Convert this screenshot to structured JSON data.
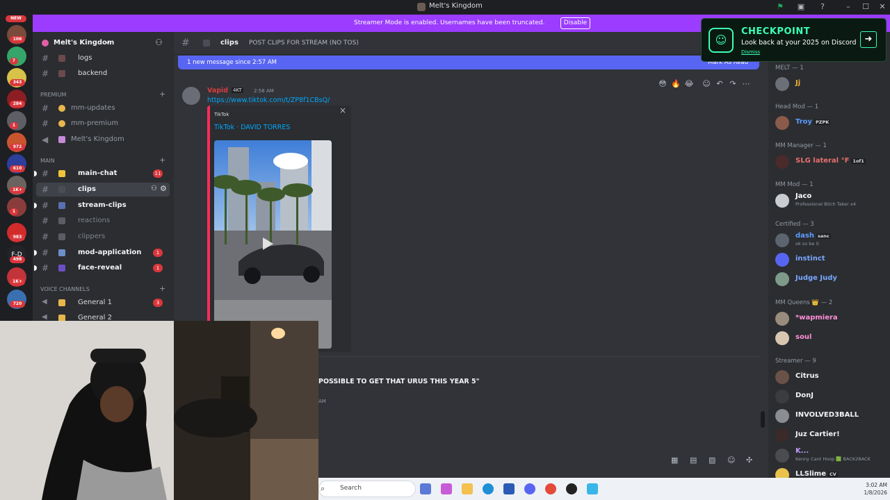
{
  "window": {
    "title": "Melt's Kingdom"
  },
  "banner": {
    "text": "Streamer Mode is enabled. Usernames have been truncated.",
    "disable_label": "Disable"
  },
  "rail": {
    "new_label": "NEW",
    "badges": [
      "106",
      "7",
      "343",
      "284",
      "1",
      "972",
      "610",
      "1K+",
      "1",
      "983",
      "498",
      "1K+",
      "720"
    ]
  },
  "guild": {
    "name": "Melt's Kingdom"
  },
  "categories": {
    "premium": "PREMIUM",
    "main": "MAIN",
    "voice": "VOICE CHANNELS"
  },
  "channels": {
    "top": [
      {
        "name": "logs"
      },
      {
        "name": "backend"
      }
    ],
    "premium": [
      {
        "name": "mm-updates"
      },
      {
        "name": "mm-premium"
      },
      {
        "name": "Melt's Kingdom"
      }
    ],
    "main": [
      {
        "name": "main-chat",
        "badge": "11"
      },
      {
        "name": "clips"
      },
      {
        "name": "stream-clips"
      },
      {
        "name": "reactions"
      },
      {
        "name": "clippers"
      },
      {
        "name": "mod-application",
        "badge": "1"
      },
      {
        "name": "face-reveal",
        "badge": "1"
      }
    ],
    "voice": [
      {
        "name": "General 1",
        "badge": "3"
      },
      {
        "name": "General 2"
      }
    ]
  },
  "header": {
    "channel": "clips",
    "topic": "POST CLIPS FOR STREAM (NO TOS)"
  },
  "new_messages": {
    "text": "1 new message since 2:57 AM",
    "mark_read": "Mark As Read"
  },
  "message": {
    "author": "Vapid",
    "badge": "4KT",
    "time": "2:58 AM",
    "link": "https://www.tiktok.com/t/ZP8f1CBsQ/",
    "embed_provider": "TikTok",
    "embed_title": "TikTok · DAVID TORRES",
    "close": "×"
  },
  "next_message": {
    "text": "POSSIBLE TO GET THAT URUS THIS YEAR 5\"",
    "time": "AM"
  },
  "checkpoint": {
    "title": "CHECKPOINT",
    "subtitle": "Look back at your 2025 on Discord",
    "dismiss": "Dismiss"
  },
  "members": {
    "groups": [
      {
        "title": "MELT — 1",
        "items": [
          {
            "name": "Jj",
            "color": "#f0b232"
          }
        ]
      },
      {
        "title": "Head Mod — 1",
        "items": [
          {
            "name": "Troy",
            "tag": "PZPK",
            "color": "#5b9cff"
          }
        ]
      },
      {
        "title": "MM Manager — 1",
        "items": [
          {
            "name": "SLG lateral °F",
            "tag": "1of1",
            "color": "#e9706c"
          }
        ]
      },
      {
        "title": "MM Mod — 1",
        "items": [
          {
            "name": "Jaco",
            "status": "Professional Bitch Taker x4",
            "color": "#ffffff"
          }
        ]
      },
      {
        "title": "Certified — 3",
        "items": [
          {
            "name": "dash",
            "tag": "sanc",
            "status": "ok so be it",
            "color": "#5b9cff"
          },
          {
            "name": "instinct",
            "color": "#7aa8ff"
          },
          {
            "name": "Judge Judy",
            "color": "#7aa8ff"
          }
        ]
      },
      {
        "title": "MM Queens 👑 — 2",
        "items": [
          {
            "name": "*wapmiera",
            "color": "#ff8fd8"
          },
          {
            "name": "soul",
            "color": "#ff8fd8"
          }
        ]
      },
      {
        "title": "Streamer — 9",
        "items": [
          {
            "name": "Citrus",
            "color": "#f2f3f5"
          },
          {
            "name": "DonJ",
            "color": "#f2f3f5"
          },
          {
            "name": "INVOLVED3BALL",
            "color": "#f2f3f5"
          },
          {
            "name": "Juz Cartier!",
            "color": "#f2f3f5"
          },
          {
            "name": "K...",
            "status": "Kenny Cant Hoop 🟩 BACK2BACK",
            "color": "#c39bff"
          },
          {
            "name": "LLSlime",
            "tag": "CV",
            "color": "#f2f3f5"
          }
        ]
      }
    ]
  },
  "taskbar": {
    "search_placeholder": "Search",
    "time": "3:02 AM",
    "date": "1/8/2026"
  }
}
